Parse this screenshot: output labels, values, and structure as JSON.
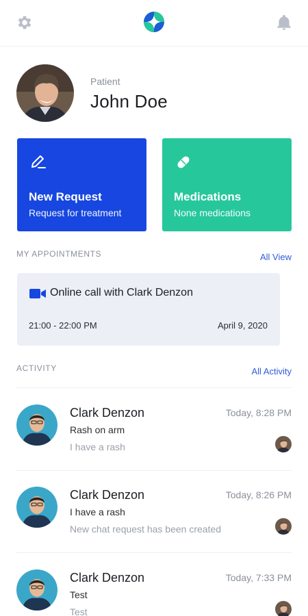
{
  "header": {
    "settings_icon": "gear-icon",
    "logo_icon": "app-logo",
    "notifications_icon": "bell-icon"
  },
  "profile": {
    "role": "Patient",
    "name": "John Doe"
  },
  "actions": [
    {
      "title": "New Request",
      "subtitle": "Request for treatment",
      "icon": "pencil-icon",
      "color": "#1747e0"
    },
    {
      "title": "Medications",
      "subtitle": "None medications",
      "icon": "pill-icon",
      "color": "#27c79c"
    }
  ],
  "appointments": {
    "title": "MY APPOINTMENTS",
    "link": "All View",
    "items": [
      {
        "icon": "video-camera-icon",
        "title": "Online call with Clark Denzon",
        "time": "21:00 - 22:00 PM",
        "date": "April 9, 2020"
      }
    ]
  },
  "activity": {
    "title": "ACTIVITY",
    "link": "All Activity",
    "items": [
      {
        "name": "Clark Denzon",
        "time": "Today, 8:28 PM",
        "line1": "Rash on arm",
        "line2": "I have a rash"
      },
      {
        "name": "Clark Denzon",
        "time": "Today, 8:26 PM",
        "line1": "I have a rash",
        "line2": "New chat request has been created"
      },
      {
        "name": "Clark Denzon",
        "time": "Today, 7:33 PM",
        "line1": "Test",
        "line2": "Test"
      }
    ]
  },
  "colors": {
    "primary": "#1747e0",
    "accent": "#27c79c",
    "link": "#2f5bd8",
    "appointment_bg": "#eceff6"
  }
}
